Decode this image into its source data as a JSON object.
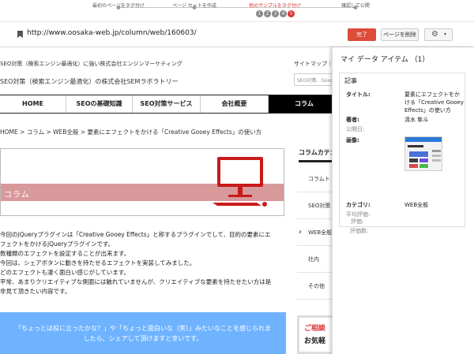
{
  "steps": {
    "items": [
      {
        "label": "最初のページをタグ付け",
        "state": "done"
      },
      {
        "label": "ページ セットを作成",
        "state": "done"
      },
      {
        "label": "他のサンプルをタグ付け",
        "state": "active"
      },
      {
        "label": "確認して公開",
        "state": "todo"
      }
    ],
    "numbers": [
      "1",
      "2",
      "3",
      "4",
      "5"
    ]
  },
  "toolbar": {
    "url": "http://www.oosaka-web.jp/column/web/160603/",
    "done_label": "完了",
    "delete_label": "ページを削除",
    "settings_caret": "▾"
  },
  "site": {
    "tagline": "SEO対策（検索エンジン最適化）に強い株式会社エンジンマーケティング",
    "links": "サイトマップ｜",
    "logo_text": "SEO対策（検索エンジン最適化）の株式会社SEMラボラトリー",
    "search_placeholder": "SEO対策、Google",
    "nav": [
      "HOME",
      "SEOの基礎知識",
      "SEO対策サービス",
      "会社概要",
      "コラム"
    ],
    "breadcrumb": "HOME > コラム > WEB全般 > 要素にエフェクトをかける「Creative Gooey Effects」の使い方",
    "hero_title": "コラム",
    "body": [
      "今回のjQueryプラグインは「Creative Gooey Effects」と称するプラグインでして、目的の要素にエ",
      "フェクトをかけるjQueryプラグインです。",
      "数種類のエフェクトを設定することが出来ます。",
      "今回は、シェアボタンに動きを持たせるエフェクトを実装してみました。",
      "どのエフェクトも凄く面白い感じがしています。",
      "平常、あまりクリエイティブな側面には触れていませんが、クリエイティブな要素を持たせたい方は是",
      "非見て頂きたい内容です。"
    ],
    "share_line1": "「ちょっとは役に立ったかな？」や「ちょっと面白いな（笑）」みたいなことを感じられま",
    "share_line2": "したら、シェアして頂けますと幸いです。",
    "sidebar_title": "コラムカテゴリー",
    "sidebar_items": [
      "コラムト",
      "SEO対策",
      "WEB全般",
      "社内",
      "その他"
    ],
    "consult_1": "ご相談",
    "consult_2": "お気軽"
  },
  "panel": {
    "title": "マイ データ アイテム （1）",
    "card_head": "記事",
    "title_label": "タイトル:",
    "title_value": "要素にエフェクトをかける「Creative Gooey Effects」の使い方",
    "author_label": "著者:",
    "author_value": "清水 隼斗",
    "published_label": "公開日:",
    "image_label": "画像:",
    "category_label": "カテゴリ:",
    "category_value": "WEB全般",
    "avg_rating_label": "平均評価:",
    "rating_label": "評価:",
    "rating_count_label": "評価数:"
  },
  "colors": {
    "accent_red": "#dd4b39",
    "hero_band": "#d8999b",
    "share_blue": "#6fb3ff",
    "pc_red": "#c81a1a"
  }
}
